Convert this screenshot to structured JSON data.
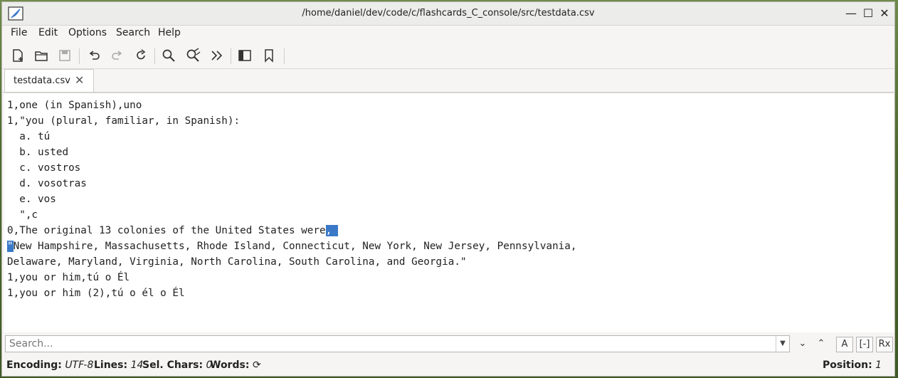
{
  "window": {
    "title": "/home/daniel/dev/code/c/flashcards_C_console/src/testdata.csv"
  },
  "menu": [
    "File",
    "Edit",
    "Options",
    "Search",
    "Help"
  ],
  "toolbar_icons": [
    "new-file-icon",
    "open-file-icon",
    "save-icon",
    "undo-icon",
    "redo-icon",
    "reload-icon",
    "search-icon",
    "search-replace-icon",
    "go-to-icon",
    "sidebar-toggle-icon",
    "bookmark-icon"
  ],
  "tab": {
    "label": "testdata.csv",
    "close": "✕"
  },
  "editor": {
    "lines": [
      "1,one (in Spanish),uno",
      "1,\"you (plural, familiar, in Spanish):",
      "  a. tú",
      "  b. usted",
      "  c. vostros",
      "  d. vosotras",
      "  e. vos",
      "  \",c",
      "0,The original 13 colonies of the United States were",
      "New Hampshire, Massachusetts, Rhode Island, Connecticut, New York, New Jersey, Pennsylvania,",
      "Delaware, Maryland, Virginia, North Carolina, South Carolina, and Georgia.\"",
      "1,you or him,tú o Él",
      "1,you or him (2),tú o él o Él"
    ],
    "selection_start": ",",
    "selection_end": "\""
  },
  "search": {
    "placeholder": "Search..."
  },
  "status": {
    "encoding_label": "Encoding:",
    "encoding_value": "UTF-8",
    "lines_label": "Lines:",
    "lines_value": "14",
    "selchars_label": "Sel. Chars:",
    "selchars_value": "0",
    "words_label": "Words:",
    "position_label": "Position:",
    "position_value": "1"
  },
  "colors": {
    "selection": "#3a79c8"
  }
}
